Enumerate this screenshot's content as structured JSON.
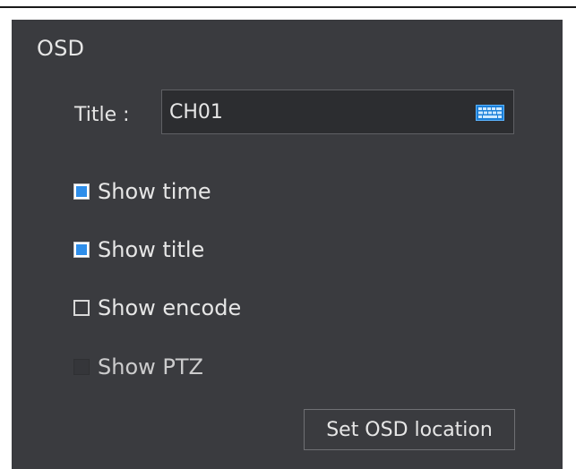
{
  "section": {
    "title": "OSD"
  },
  "title_field": {
    "label": "Title :",
    "value": "CH01",
    "icon": "keyboard-icon"
  },
  "options": [
    {
      "label": "Show time",
      "checked": true,
      "enabled": true
    },
    {
      "label": "Show title",
      "checked": true,
      "enabled": true
    },
    {
      "label": "Show encode",
      "checked": false,
      "enabled": true
    },
    {
      "label": "Show PTZ",
      "checked": false,
      "enabled": false
    }
  ],
  "buttons": {
    "set_location": "Set OSD location"
  },
  "colors": {
    "panel_bg": "#3a3b3f",
    "input_bg": "#2c2d30",
    "accent": "#2e8eea",
    "text": "#e6e6e6"
  }
}
